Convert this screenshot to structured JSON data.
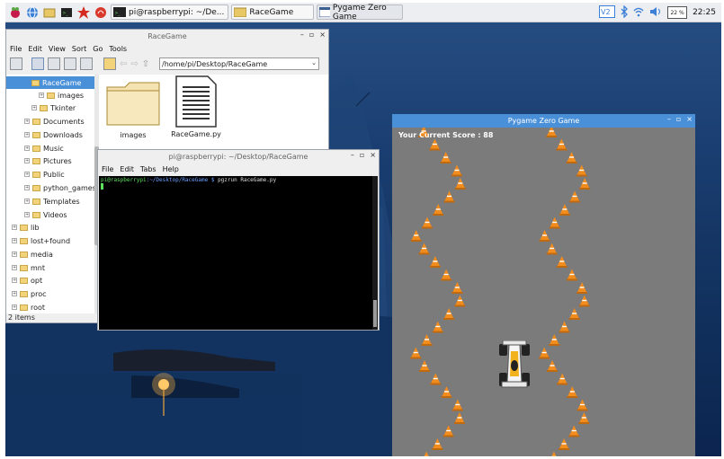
{
  "taskbar": {
    "tasks": [
      {
        "label": "pi@raspberrypi: ~/De..."
      },
      {
        "label": "RaceGame"
      },
      {
        "label": "Pygame Zero Game"
      }
    ],
    "cpu_label": "22 %",
    "clock": "22:25"
  },
  "file_manager": {
    "title": "RaceGame",
    "menu": [
      "File",
      "Edit",
      "View",
      "Sort",
      "Go",
      "Tools"
    ],
    "path": "/home/pi/Desktop/RaceGame",
    "tree": [
      {
        "label": "RaceGame",
        "selected": true
      },
      {
        "label": "images"
      },
      {
        "label": "Tkinter"
      },
      {
        "label": "Documents"
      },
      {
        "label": "Downloads"
      },
      {
        "label": "Music"
      },
      {
        "label": "Pictures"
      },
      {
        "label": "Public"
      },
      {
        "label": "python_games"
      },
      {
        "label": "Templates"
      },
      {
        "label": "Videos"
      },
      {
        "label": "lib"
      },
      {
        "label": "lost+found"
      },
      {
        "label": "media"
      },
      {
        "label": "mnt"
      },
      {
        "label": "opt"
      },
      {
        "label": "proc"
      },
      {
        "label": "root"
      }
    ],
    "files": [
      {
        "name": "images",
        "icon": "folder-icon"
      },
      {
        "name": "RaceGame.py",
        "icon": "text-file-icon"
      }
    ],
    "status": "2 items"
  },
  "terminal": {
    "title": "pi@raspberrypi: ~/Desktop/RaceGame",
    "menu": [
      "File",
      "Edit",
      "Tabs",
      "Help"
    ],
    "prompt_user": "pi@raspberrypi",
    "prompt_path": ":~/Desktop/RaceGame $",
    "command": "pgzrun RaceGame.py"
  },
  "game": {
    "title": "Pygame Zero Game",
    "score_text": "Your Current Score : 88",
    "colors": {
      "track": "#7b7b7b",
      "cone": "#f28c1c",
      "title_bar": "#4a90d9"
    }
  },
  "window_controls": {
    "minimize": "–",
    "maximize": "▫",
    "close": "×"
  }
}
